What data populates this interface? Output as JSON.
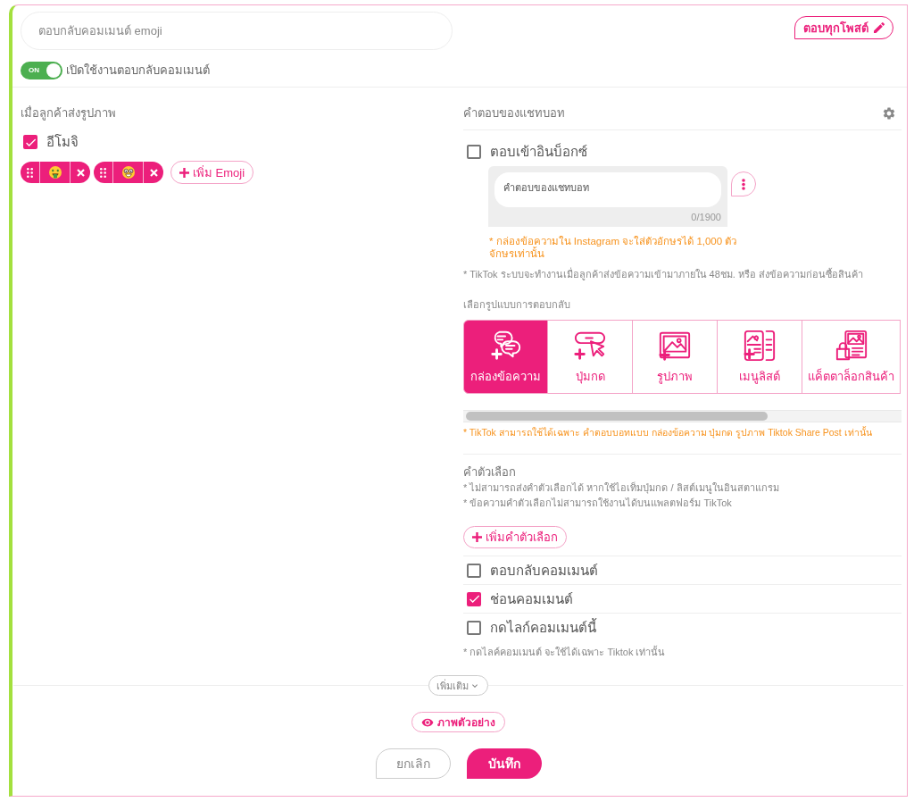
{
  "rule_name": {
    "value": "ตอบกลับคอมเมนต์ emoji"
  },
  "reply_all_posts_button": {
    "label": "ตอบทุกโพสต์"
  },
  "enable_toggle": {
    "on": true,
    "state_label": "ON",
    "label": "เปิดใช้งานตอบกลับคอมเมนต์"
  },
  "trigger": {
    "title": "เมื่อลูกค้าส่งรูปภาพ",
    "emoji_option": {
      "label": "อีโมจิ",
      "checked": true
    },
    "emojis": [
      {
        "kind": "money-mouth"
      },
      {
        "kind": "nerd"
      }
    ],
    "add_button": "เพิ่ม Emoji"
  },
  "response": {
    "title": "คำตอบของแชทบอท",
    "inbox_option": {
      "label": "ตอบเข้าอินบ็อกซ์",
      "checked": false
    },
    "message": {
      "placeholder": "คำตอบของแชทบอท",
      "counter": "0/1900"
    },
    "instagram_note": "* กล่องข้อความใน Instagram จะใส่ตัวอักษรได้ 1,000 ตัวจักษรเท่านั้น",
    "tiktok_note": "* TikTok ระบบจะทำงานเมื่อลูกค้าส่งข้อความเข้ามาภายใน 48ชม. หรือ ส่งข้อความก่อนซื้อสินค้า",
    "type_label": "เลือกรูปแบบการตอบกลับ",
    "types": [
      {
        "kind": "text-box",
        "label": "กล่องข้อความ",
        "selected": true
      },
      {
        "kind": "button",
        "label": "ปุ่มกด",
        "selected": false
      },
      {
        "kind": "image",
        "label": "รูปภาพ",
        "selected": false
      },
      {
        "kind": "list-menu",
        "label": "เมนูลิสต์",
        "selected": false
      },
      {
        "kind": "catalog",
        "label": "แค็ตตาล็อกสินค้า",
        "selected": false
      }
    ],
    "tiktok_types_note": "* TikTok สามารถใช้ได้เฉพาะ คำตอบบอทแบบ กล่องข้อความ ปุ่มกด รูปภาพ Tiktok Share Post เท่านั้น",
    "quick_replies": {
      "title": "คำตัวเลือก",
      "notes": [
        "* ไม่สามารถส่งคำตัวเลือกได้ หากใช้ไอเท็มปุ่มกด / ลิสต์เมนูในอินสตาแกรม",
        "* ข้อความคำตัวเลือกไม่สามารถใช้งานได้บนแพลตฟอร์ม TikTok"
      ],
      "add_button": "เพิ่มคำตัวเลือก"
    },
    "actions": [
      {
        "label": "ตอบกลับคอมเมนต์",
        "checked": false
      },
      {
        "label": "ช่อนคอมเมนต์",
        "checked": true
      },
      {
        "label": "กดไลก์คอมเมนต์นี้",
        "checked": false
      }
    ],
    "like_note": "* กดไลค์คอมเมนต์ จะใช้ได้เฉพาะ Tiktok เท่านั้น"
  },
  "more_button": "เพิ่มเติม",
  "preview_button": "ภาพตัวอย่าง",
  "buttons": {
    "cancel": "ยกเลิก",
    "save": "บันทึก"
  }
}
